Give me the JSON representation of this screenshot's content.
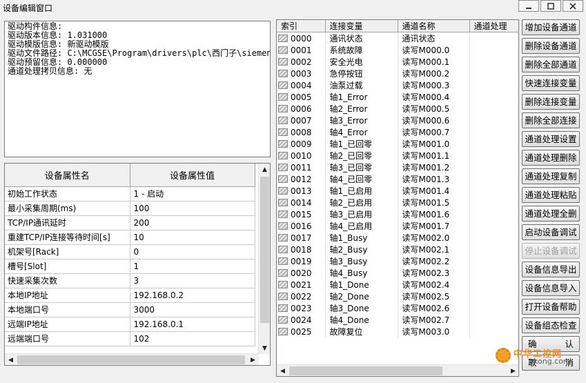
{
  "window": {
    "title": "设备编辑窗口"
  },
  "info_lines": [
    "驱动构件信息:",
    "驱动版本信息: 1.031000",
    "驱动模版信息: 新驱动模版",
    "驱动文件路径: C:\\MCGSE\\Program\\drivers\\plc\\西门子\\siemen",
    "驱动预留信息: 0.000000",
    "通道处理拷贝信息: 无"
  ],
  "props": {
    "headers": [
      "设备属性名",
      "设备属性值"
    ],
    "rows": [
      {
        "name": "初始工作状态",
        "value": "1 - 启动"
      },
      {
        "name": "最小采集周期(ms)",
        "value": "100"
      },
      {
        "name": "TCP/IP通讯延时",
        "value": "200"
      },
      {
        "name": "重建TCP/IP连接等待时间[s]",
        "value": "10"
      },
      {
        "name": "机架号[Rack]",
        "value": "0"
      },
      {
        "name": "槽号[Slot]",
        "value": "1"
      },
      {
        "name": "快速采集次数",
        "value": "3"
      },
      {
        "name": "本地IP地址",
        "value": "192.168.0.2"
      },
      {
        "name": "本地端口号",
        "value": "3000"
      },
      {
        "name": "远端IP地址",
        "value": "192.168.0.1"
      },
      {
        "name": "远端端口号",
        "value": "102"
      }
    ]
  },
  "channels": {
    "headers": [
      "索引",
      "连接变量",
      "通道名称",
      "通道处理"
    ],
    "rows": [
      {
        "index": "0000",
        "var": "通讯状态",
        "name": "通讯状态",
        "proc": ""
      },
      {
        "index": "0001",
        "var": "系统故障",
        "name": "读写M000.0",
        "proc": ""
      },
      {
        "index": "0002",
        "var": "安全光电",
        "name": "读写M000.1",
        "proc": ""
      },
      {
        "index": "0003",
        "var": "急停按钮",
        "name": "读写M000.2",
        "proc": ""
      },
      {
        "index": "0004",
        "var": "油泵过载",
        "name": "读写M000.3",
        "proc": ""
      },
      {
        "index": "0005",
        "var": "轴1_Error",
        "name": "读写M000.4",
        "proc": ""
      },
      {
        "index": "0006",
        "var": "轴2_Error",
        "name": "读写M000.5",
        "proc": ""
      },
      {
        "index": "0007",
        "var": "轴3_Error",
        "name": "读写M000.6",
        "proc": ""
      },
      {
        "index": "0008",
        "var": "轴4_Error",
        "name": "读写M000.7",
        "proc": ""
      },
      {
        "index": "0009",
        "var": "轴1_已回零",
        "name": "读写M001.0",
        "proc": ""
      },
      {
        "index": "0010",
        "var": "轴2_已回零",
        "name": "读写M001.1",
        "proc": ""
      },
      {
        "index": "0011",
        "var": "轴3_已回零",
        "name": "读写M001.2",
        "proc": ""
      },
      {
        "index": "0012",
        "var": "轴4_已回零",
        "name": "读写M001.3",
        "proc": ""
      },
      {
        "index": "0013",
        "var": "轴1_已启用",
        "name": "读写M001.4",
        "proc": ""
      },
      {
        "index": "0014",
        "var": "轴2_已启用",
        "name": "读写M001.5",
        "proc": ""
      },
      {
        "index": "0015",
        "var": "轴3_已启用",
        "name": "读写M001.6",
        "proc": ""
      },
      {
        "index": "0016",
        "var": "轴4_已启用",
        "name": "读写M001.7",
        "proc": ""
      },
      {
        "index": "0017",
        "var": "轴1_Busy",
        "name": "读写M002.0",
        "proc": ""
      },
      {
        "index": "0018",
        "var": "轴2_Busy",
        "name": "读写M002.1",
        "proc": ""
      },
      {
        "index": "0019",
        "var": "轴3_Busy",
        "name": "读写M002.2",
        "proc": ""
      },
      {
        "index": "0020",
        "var": "轴4_Busy",
        "name": "读写M002.3",
        "proc": ""
      },
      {
        "index": "0021",
        "var": "轴1_Done",
        "name": "读写M002.4",
        "proc": ""
      },
      {
        "index": "0022",
        "var": "轴2_Done",
        "name": "读写M002.5",
        "proc": ""
      },
      {
        "index": "0023",
        "var": "轴3_Done",
        "name": "读写M002.6",
        "proc": ""
      },
      {
        "index": "0024",
        "var": "轴4_Done",
        "name": "读写M002.7",
        "proc": ""
      },
      {
        "index": "0025",
        "var": "故障复位",
        "name": "读写M003.0",
        "proc": ""
      }
    ]
  },
  "buttons": [
    {
      "label": "增加设备通道",
      "enabled": true
    },
    {
      "label": "删除设备通道",
      "enabled": true
    },
    {
      "label": "删除全部通道",
      "enabled": true
    },
    {
      "label": "快速连接变量",
      "enabled": true
    },
    {
      "label": "删除连接变量",
      "enabled": true
    },
    {
      "label": "删除全部连接",
      "enabled": true
    },
    {
      "label": "通道处理设置",
      "enabled": true
    },
    {
      "label": "通道处理删除",
      "enabled": true
    },
    {
      "label": "通道处理复制",
      "enabled": true
    },
    {
      "label": "通道处理粘贴",
      "enabled": true
    },
    {
      "label": "通道处理全删",
      "enabled": true
    },
    {
      "label": "启动设备调试",
      "enabled": true
    },
    {
      "label": "停止设备调试",
      "enabled": false
    },
    {
      "label": "设备信息导出",
      "enabled": true
    },
    {
      "label": "设备信息导入",
      "enabled": true
    },
    {
      "label": "打开设备帮助",
      "enabled": true
    },
    {
      "label": "设备组态检查",
      "enabled": true
    },
    {
      "label": "确      认",
      "enabled": true
    },
    {
      "label": "取      消",
      "enabled": true
    }
  ],
  "watermark": {
    "text1": "中华工控网",
    "text2": "gkong.com"
  },
  "colors": {
    "disabled_text": "#a0a0a0",
    "watermark_orange": "#f08a1c"
  }
}
